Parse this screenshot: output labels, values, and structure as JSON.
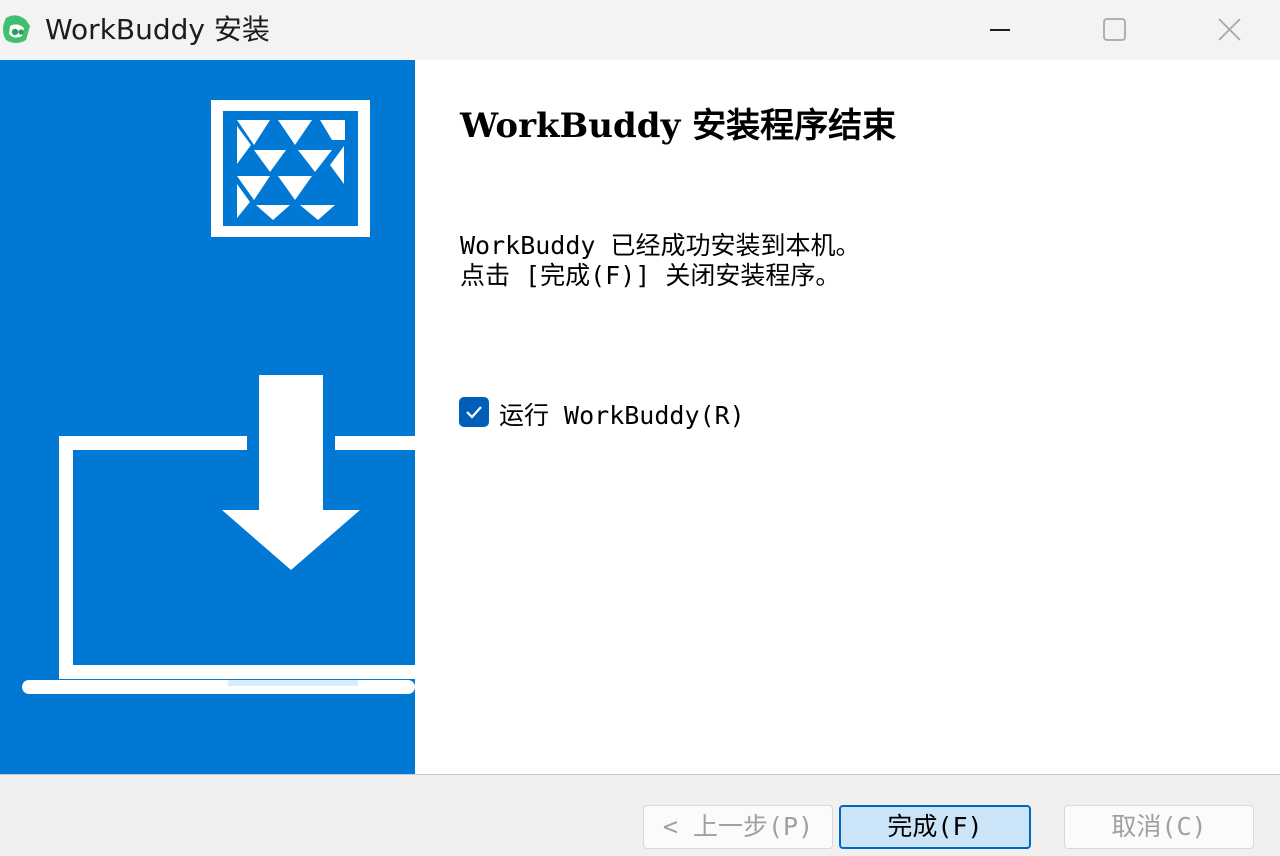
{
  "window": {
    "title": "WorkBuddy 安装",
    "app_icon": "workbuddy-logo-icon",
    "controls": [
      "minimize-icon",
      "maximize-icon",
      "close-icon"
    ]
  },
  "banner": {
    "logo_icon": "nsis-logo-icon",
    "illustration": "laptop-download-icon",
    "background_color": "#0078d4"
  },
  "content": {
    "heading": "WorkBuddy 安装程序结束",
    "message_line1": "WorkBuddy 已经成功安装到本机。",
    "message_line2": "点击 [完成(F)] 关闭安装程序。",
    "run_checkbox": {
      "label": "运行 WorkBuddy(R)",
      "checked": true
    }
  },
  "footer": {
    "back_label": "< 上一步(P)",
    "finish_label": "完成(F)",
    "cancel_label": "取消(C)"
  },
  "colors": {
    "accent": "#0078d4",
    "checkbox": "#005fb8",
    "default_button_border": "#0067c0"
  }
}
